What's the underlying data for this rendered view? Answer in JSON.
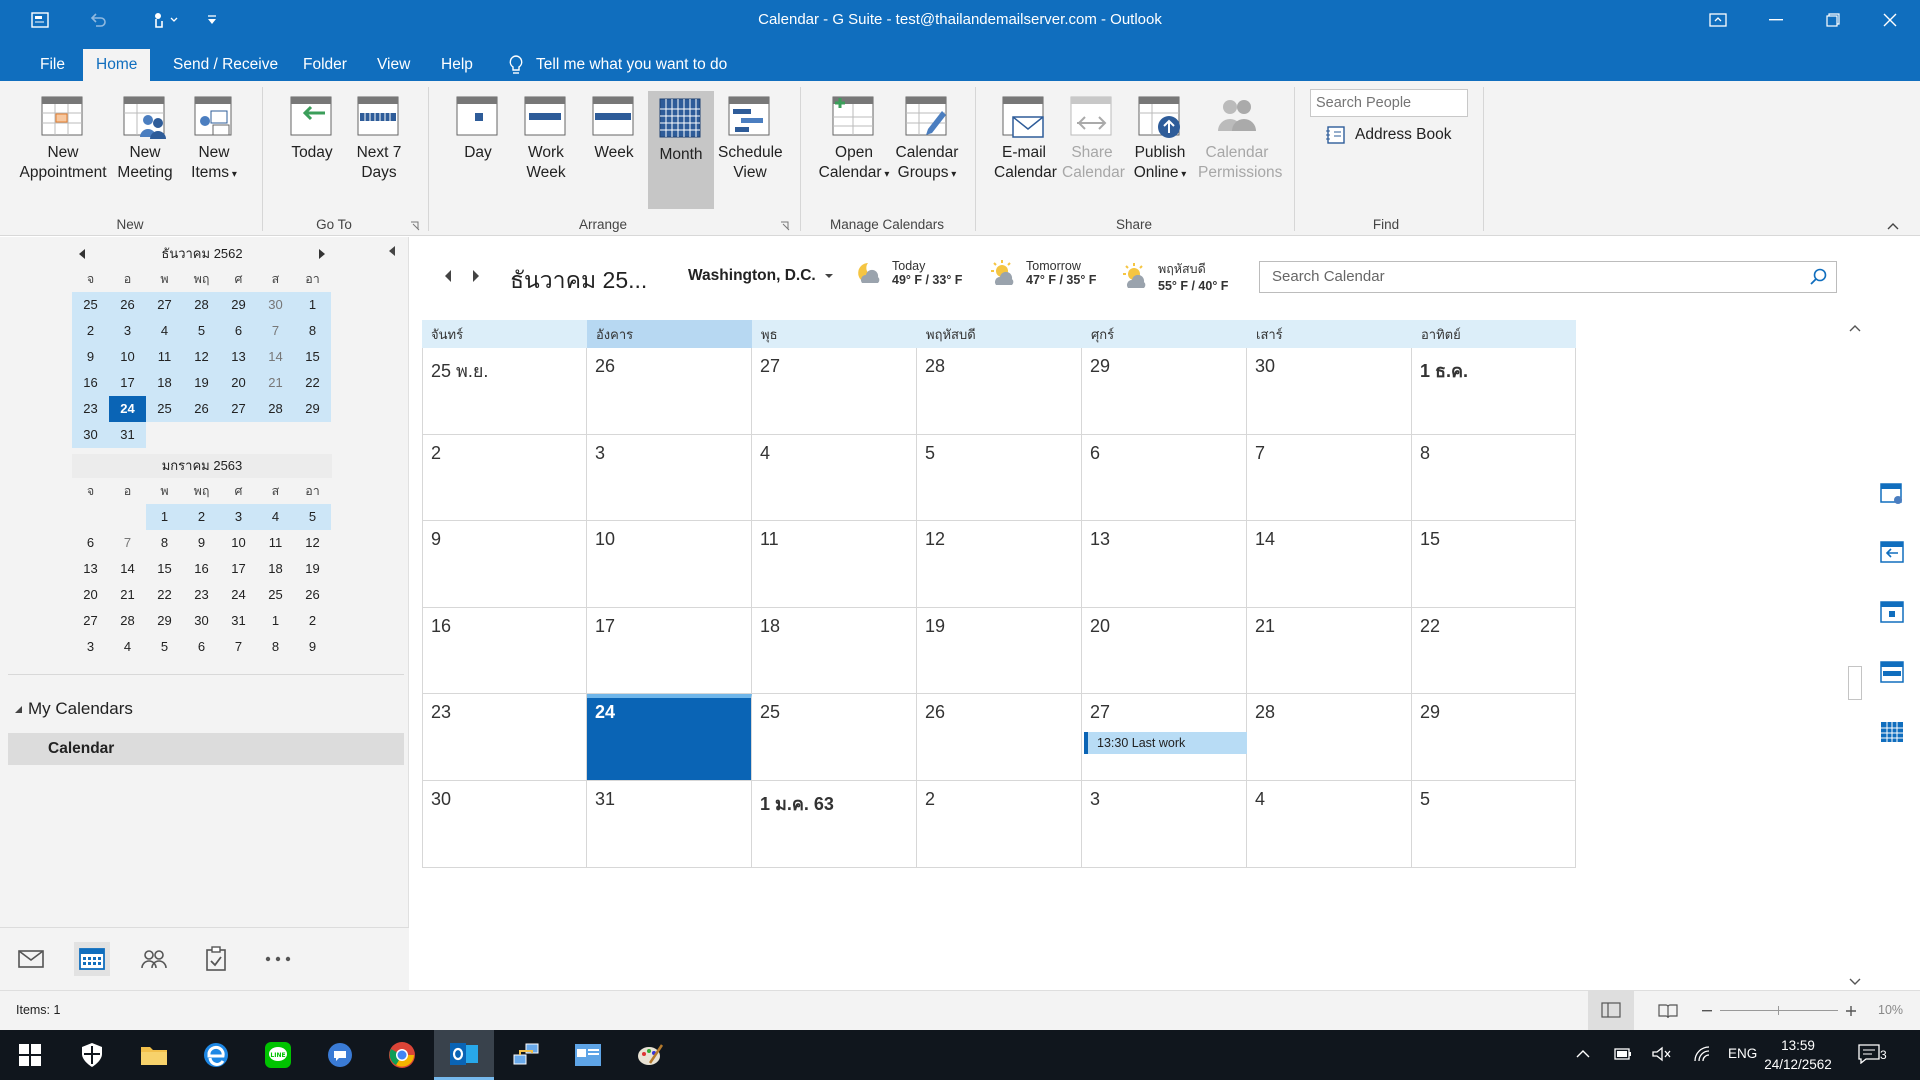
{
  "window": {
    "title": "Calendar - G Suite - test@thailandemailserver.com  -  Outlook"
  },
  "ribbon_tabs": [
    "File",
    "Home",
    "Send / Receive",
    "Folder",
    "View",
    "Help"
  ],
  "tell_me": "Tell me what you want to do",
  "ribbon": {
    "new_appointment": "New Appointment",
    "new_meeting": "New Meeting",
    "new_items": "New Items",
    "today": "Today",
    "next7": "Next 7 Days",
    "day": "Day",
    "work_week": "Work Week",
    "week": "Week",
    "month": "Month",
    "schedule_view": "Schedule View",
    "open_calendar": "Open Calendar",
    "calendar_groups": "Calendar Groups",
    "email_calendar": "E-mail Calendar",
    "share_calendar": "Share Calendar",
    "publish_online": "Publish Online",
    "calendar_permissions": "Calendar Permissions",
    "search_people_placeholder": "Search People",
    "address_book": "Address Book",
    "groups": {
      "new": "New",
      "goto": "Go To",
      "arrange": "Arrange",
      "manage": "Manage Calendars",
      "share": "Share",
      "find": "Find"
    }
  },
  "mini_calendar_1": {
    "title": "ธันวาคม 2562",
    "day_names": [
      "จ",
      "อ",
      "พ",
      "พฤ",
      "ศ",
      "ส",
      "อา"
    ],
    "days": [
      [
        "25",
        "26",
        "27",
        "28",
        "29",
        "30",
        "1"
      ],
      [
        "2",
        "3",
        "4",
        "5",
        "6",
        "7",
        "8"
      ],
      [
        "9",
        "10",
        "11",
        "12",
        "13",
        "14",
        "15"
      ],
      [
        "16",
        "17",
        "18",
        "19",
        "20",
        "21",
        "22"
      ],
      [
        "23",
        "24",
        "25",
        "26",
        "27",
        "28",
        "29"
      ],
      [
        "30",
        "31",
        "",
        "",
        "",
        "",
        ""
      ]
    ]
  },
  "mini_calendar_2": {
    "title": "มกราคม 2563",
    "day_names": [
      "จ",
      "อ",
      "พ",
      "พฤ",
      "ศ",
      "ส",
      "อา"
    ],
    "days": [
      [
        "",
        "",
        "1",
        "2",
        "3",
        "4",
        "5"
      ],
      [
        "6",
        "7",
        "8",
        "9",
        "10",
        "11",
        "12"
      ],
      [
        "13",
        "14",
        "15",
        "16",
        "17",
        "18",
        "19"
      ],
      [
        "20",
        "21",
        "22",
        "23",
        "24",
        "25",
        "26"
      ],
      [
        "27",
        "28",
        "29",
        "30",
        "31",
        "1",
        "2"
      ],
      [
        "3",
        "4",
        "5",
        "6",
        "7",
        "8",
        "9"
      ]
    ]
  },
  "my_calendars": {
    "heading": "My Calendars",
    "items": [
      "Calendar"
    ]
  },
  "calendar_header": {
    "month_title": "ธันวาคม 25...",
    "location": "Washington,  D.C.",
    "weather": [
      {
        "label": "Today",
        "temps": "49° F / 33° F",
        "icon": "moon-cloud-icon"
      },
      {
        "label": "Tomorrow",
        "temps": "47° F / 35° F",
        "icon": "sun-cloud-icon"
      },
      {
        "label": "พฤหัสบดี",
        "temps": "55° F / 40° F",
        "icon": "sun-cloud-icon"
      }
    ],
    "search_placeholder": "Search Calendar"
  },
  "month_view": {
    "day_headers": [
      "จันทร์",
      "อังคาร",
      "พุธ",
      "พฤหัสบดี",
      "ศุกร์",
      "เสาร์",
      "อาทิตย์"
    ],
    "current_weekday_index": 1,
    "weeks": [
      [
        "25 พ.ย.",
        "26",
        "27",
        "28",
        "29",
        "30",
        "1 ธ.ค."
      ],
      [
        "2",
        "3",
        "4",
        "5",
        "6",
        "7",
        "8"
      ],
      [
        "9",
        "10",
        "11",
        "12",
        "13",
        "14",
        "15"
      ],
      [
        "16",
        "17",
        "18",
        "19",
        "20",
        "21",
        "22"
      ],
      [
        "23",
        "24",
        "25",
        "26",
        "27",
        "28",
        "29"
      ],
      [
        "30",
        "31",
        "1 ม.ค. 63",
        "2",
        "3",
        "4",
        "5"
      ]
    ],
    "event": {
      "text": "13:30 Last work"
    }
  },
  "status": {
    "items": "Items: 1",
    "zoom": "10%"
  },
  "taskbar": {
    "time": "13:59",
    "date": "24/12/2562",
    "lang": "ENG",
    "notifications": "3"
  },
  "colors": {
    "accent": "#106ebe",
    "today": "#0a64b5",
    "highlight": "#cde6f7",
    "event": "#b8dcf5"
  }
}
